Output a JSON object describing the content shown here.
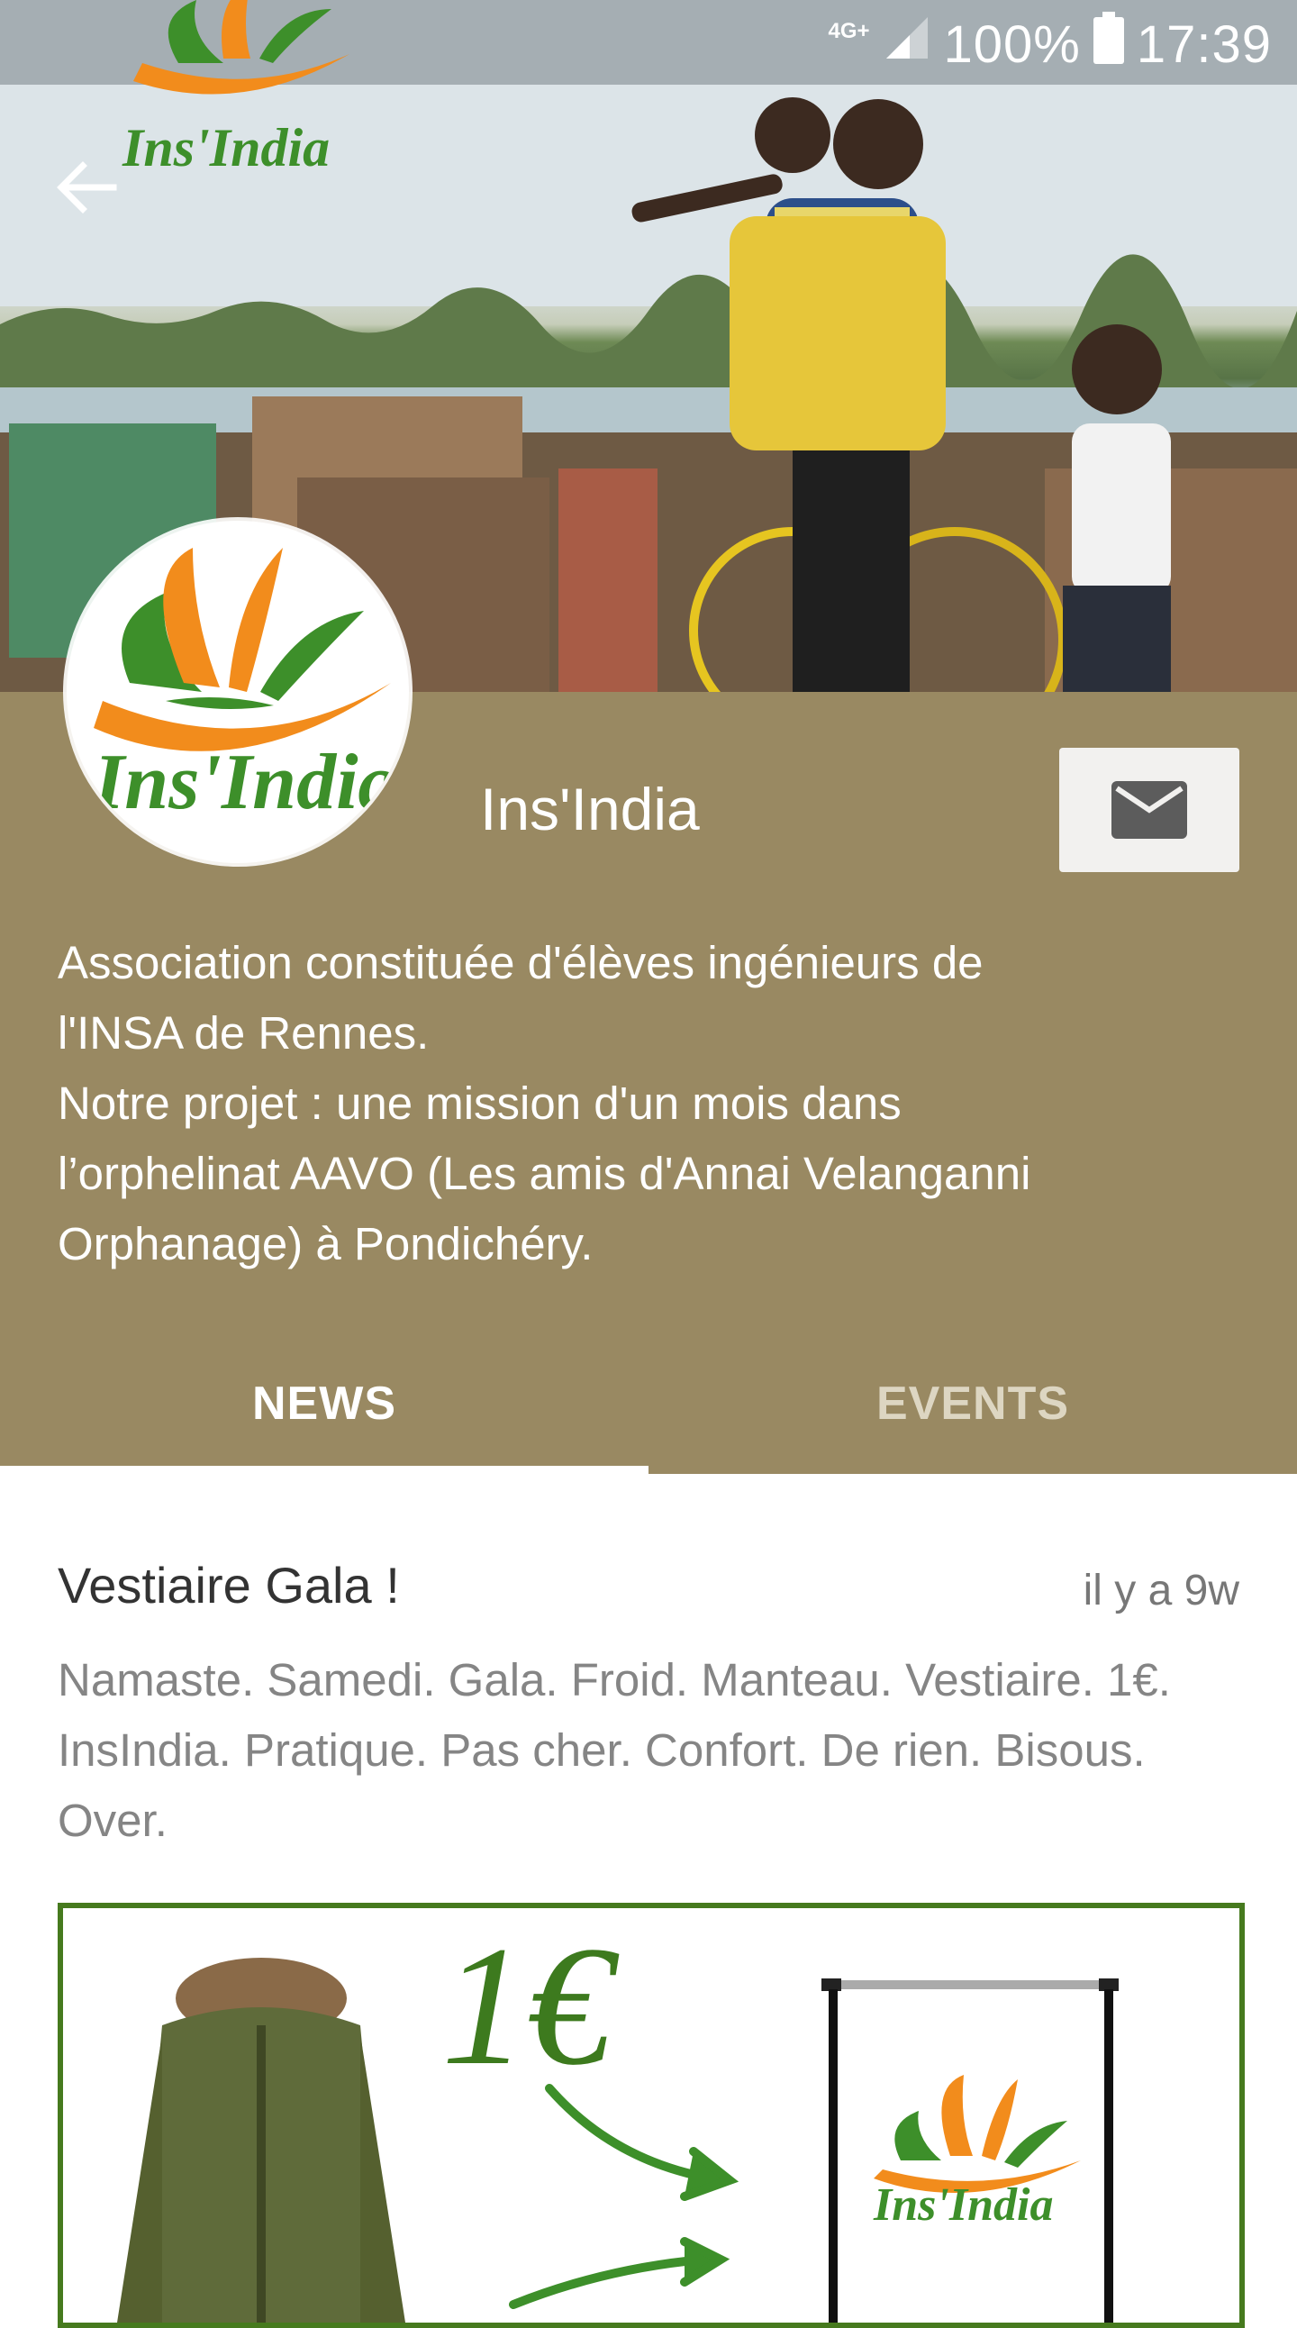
{
  "status_bar": {
    "network": "4G+",
    "battery": "100%",
    "time": "17:39"
  },
  "header": {
    "banner_logo_text": "Ins'India"
  },
  "profile": {
    "avatar_text": "Ins'India",
    "name": "Ins'India",
    "description": "Association constituée d'élèves ingénieurs de\nl'INSA de Rennes.\nNotre projet : une mission d'un mois dans\nl’orphelinat AAVO (Les amis d'Annai Velanganni\nOrphanage) à Pondichéry."
  },
  "tabs": [
    {
      "label": "NEWS",
      "active": true
    },
    {
      "label": "EVENTS",
      "active": false
    }
  ],
  "news": [
    {
      "title": "Vestiaire Gala !",
      "time": "il y a 9w",
      "body": "Namaste. Samedi. Gala. Froid. Manteau. Vestiaire. 1€. InsIndia. Pratique. Pas cher. Confort. De rien. Bisous. Over.",
      "image": {
        "price": "1€",
        "logo_text": "Ins'India"
      }
    }
  ],
  "colors": {
    "band": "#998962",
    "brand_green": "#3d8f2a",
    "brand_orange": "#f28c1c"
  },
  "icons": {
    "back": "arrow-left-icon",
    "mail": "mail-icon",
    "signal": "signal-icon",
    "battery": "battery-icon"
  }
}
